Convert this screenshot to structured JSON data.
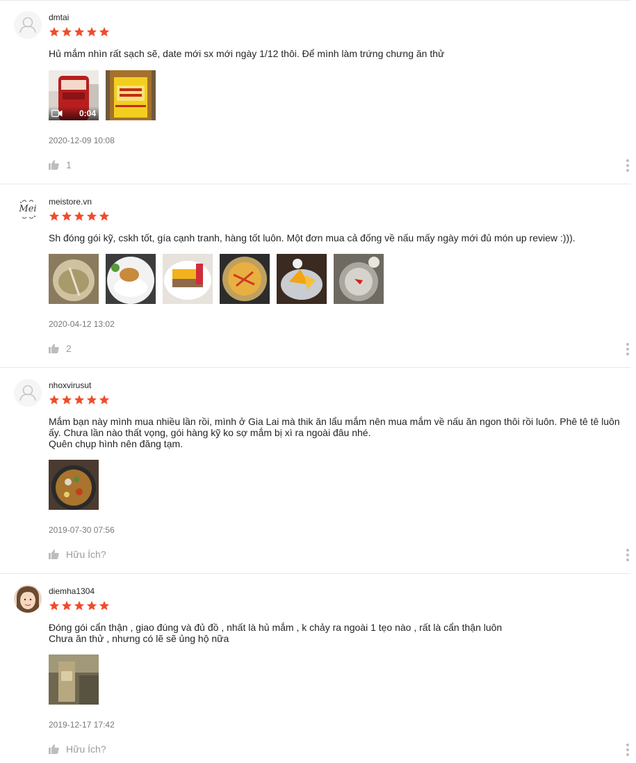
{
  "colors": {
    "star": "#ee4d2d",
    "divider": "#e8e8e8",
    "muted": "#9e9e9e"
  },
  "reviews": [
    {
      "username": "dmtai",
      "rating": 5,
      "content": "Hủ mắm nhìn rất sạch sẽ, date mới sx mới ngày 1/12 thôi. Để mình làm trứng chưng ăn thử",
      "video_duration": "0:04",
      "date": "2020-12-09 10:08",
      "likes": "1"
    },
    {
      "username": "meistore.vn",
      "avatar_text": "Mei",
      "rating": 5,
      "content": "Sh đóng gói kỹ, cskh tốt, gía cạnh tranh, hàng tốt luôn. Một đơn mua cả đống về nấu mấy ngày mới đủ món up review :))).",
      "date": "2020-04-12 13:02",
      "likes": "2"
    },
    {
      "username": "nhoxvirusut",
      "rating": 5,
      "content": "Mắm bạn này mình mua nhiều lần rồi, mình ở Gia Lai mà thik ăn lẩu mắm nên mua mắm về nấu ăn ngon thôi rồi luôn. Phê tê tê luôn ấy. Chưa lần nào thất vọng, gói hàng kỹ ko sợ mắm bị xì ra ngoài đâu nhé.\nQuên chụp hình nên đăng tạm.",
      "date": "2019-07-30 07:56",
      "likes": "Hữu Ích?"
    },
    {
      "username": "diemha1304",
      "rating": 5,
      "content": "Đóng gói cẩn thận , giao đúng và đủ đồ , nhất là hủ mắm , k chảy ra ngoài 1 tẹo nào , rất là cẩn thận luôn\nChưa ăn thử , nhưng có lẽ sẽ ủng hộ nữa",
      "date": "2019-12-17 17:42",
      "likes": "Hữu Ích?"
    }
  ]
}
